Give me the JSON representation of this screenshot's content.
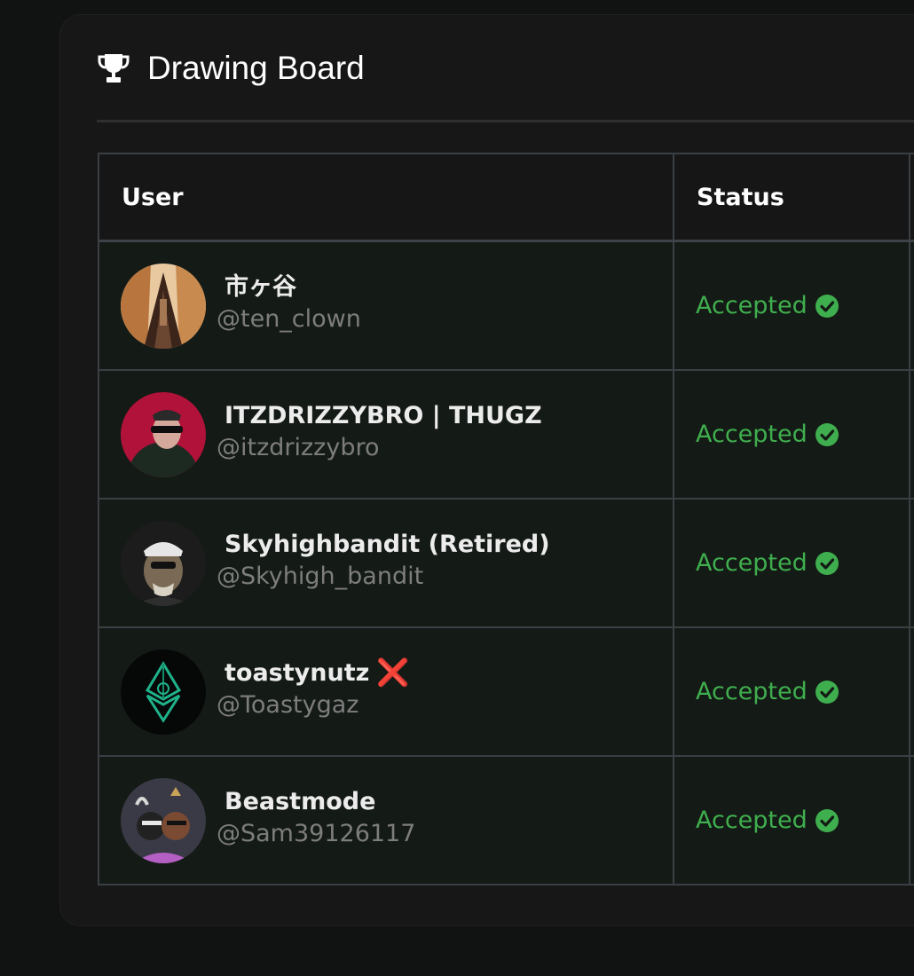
{
  "card": {
    "title": "Drawing Board"
  },
  "table": {
    "headers": [
      "User",
      "Status"
    ],
    "rows": [
      {
        "name": "市ヶ谷",
        "handle": "@ten_clown",
        "status": "Accepted",
        "flag": ""
      },
      {
        "name": "ITZDRIZZYBRO | THUGZ",
        "handle": "@itzdrizzybro",
        "status": "Accepted",
        "flag": ""
      },
      {
        "name": "Skyhighbandit (Retired)",
        "handle": "@Skyhigh_bandit",
        "status": "Accepted",
        "flag": ""
      },
      {
        "name": "toastynutz",
        "handle": "@Toastygaz",
        "status": "Accepted",
        "flag": "❌"
      },
      {
        "name": "Beastmode",
        "handle": "@Sam39126117",
        "status": "Accepted",
        "flag": ""
      }
    ]
  },
  "colors": {
    "accepted": "#3fae4e",
    "background": "#111312",
    "card": "#171717",
    "row": "#141a15"
  },
  "icons": {
    "header": "trophy-icon",
    "status": "check-circle-icon",
    "flag": "cross-mark-icon"
  }
}
